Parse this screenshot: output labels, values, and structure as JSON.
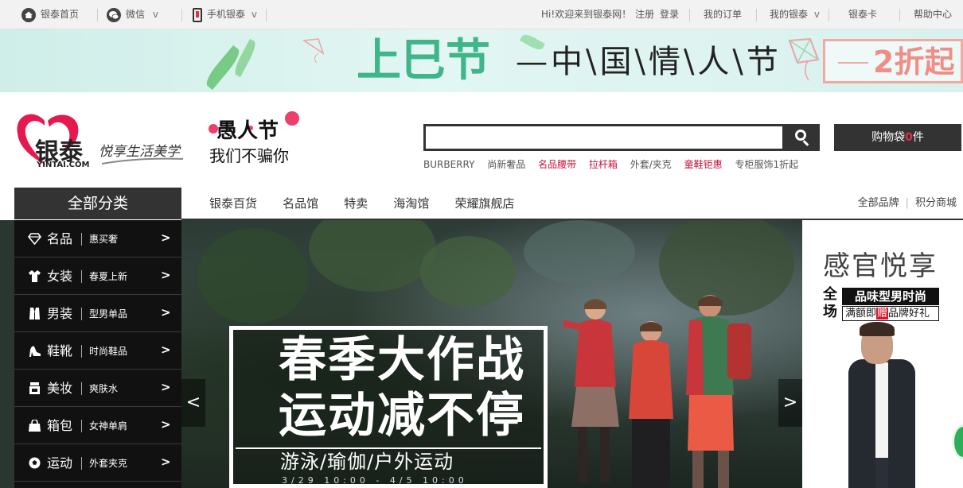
{
  "topbar": {
    "home_label": "银泰首页",
    "wechat_label": "微信",
    "wechat_caret": "v",
    "mobile_label": "手机银泰",
    "mobile_caret": "v",
    "greeting": "Hi!欢迎来到银泰网！",
    "register": "注册",
    "login": "登录",
    "my_orders": "我的订单",
    "my_yintai": "我的银泰",
    "my_yintai_caret": "v",
    "card": "银泰卡",
    "help": "帮助中心"
  },
  "banner": {
    "title": "上巳节",
    "subtitle": "—中\\国\\情\\人\\节",
    "discount": "2折起"
  },
  "header": {
    "logo_text": "银泰",
    "logo_en": "YINTAI.COM",
    "slogan": "悦享生活美学",
    "promo_title": "愚人节",
    "promo_sub": "我们不骗你",
    "search_value": "",
    "cart_label": "购物袋",
    "cart_count": "0",
    "cart_unit": "件",
    "hot_words": [
      {
        "text": "BURBERRY",
        "highlight": false
      },
      {
        "text": "尚新奢品",
        "highlight": false
      },
      {
        "text": "名品腰带",
        "highlight": true
      },
      {
        "text": "拉杆箱",
        "highlight": true
      },
      {
        "text": "外套/夹克",
        "highlight": false
      },
      {
        "text": "童鞋钜惠",
        "highlight": true
      },
      {
        "text": "专柜服饰1折起",
        "highlight": false
      }
    ]
  },
  "nav": {
    "all_categories": "全部分类",
    "main": [
      "银泰百货",
      "名品馆",
      "特卖",
      "海淘馆",
      "荣耀旗舰店"
    ],
    "right": [
      "全部品牌",
      "积分商城"
    ]
  },
  "categories": [
    {
      "name": "名品",
      "sub": "惠买奢",
      "icon": "diamond-icon"
    },
    {
      "name": "女装",
      "sub": "春夏上新",
      "icon": "dress-icon"
    },
    {
      "name": "男装",
      "sub": "型男单品",
      "icon": "suit-icon"
    },
    {
      "name": "鞋靴",
      "sub": "时尚鞋品",
      "icon": "heel-shoe-icon"
    },
    {
      "name": "美妆",
      "sub": "爽肤水",
      "icon": "cosmetic-icon"
    },
    {
      "name": "箱包",
      "sub": "女神单肩",
      "icon": "handbag-icon"
    },
    {
      "name": "运动",
      "sub": "外套夹克",
      "icon": "football-icon"
    }
  ],
  "category_arrow": ">",
  "hero": {
    "line1": "春季大作战",
    "line2": "运动减不停",
    "line3": "游泳/瑜伽/户外运动",
    "date": "3/29 10:00 - 4/5 10:00",
    "prev": "<",
    "next": ">"
  },
  "right_ad": {
    "title": "感官悦享",
    "all_label": "全场",
    "tag1": "品味型男时尚",
    "tag2_prefix": "满额即",
    "tag2_gift": "赠",
    "tag2_suffix": "品牌好礼"
  },
  "colors": {
    "accent_red": "#c8123a",
    "dark_bar": "#333333",
    "banner_green": "#3fb58a"
  }
}
